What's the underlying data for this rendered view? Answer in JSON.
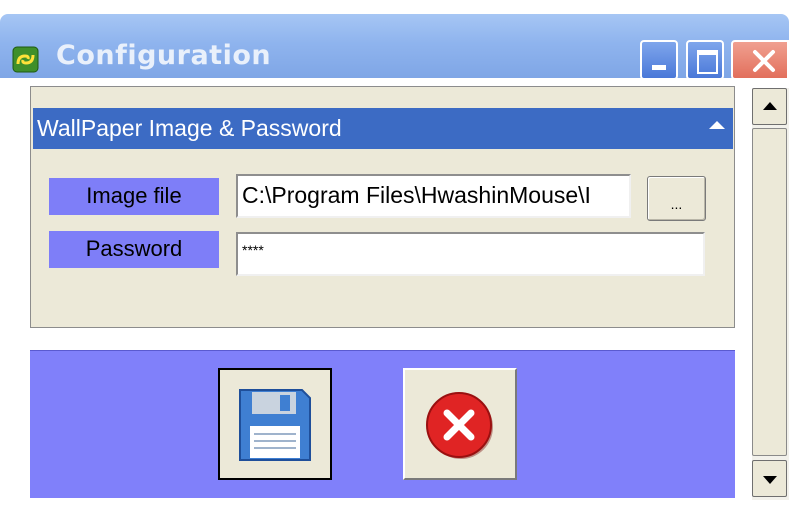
{
  "window": {
    "title": "Configuration",
    "icon": "app-green-link-icon",
    "title_bar_color": "#8fb4ee",
    "controls": [
      "minimize-icon",
      "maximize-icon",
      "close-icon"
    ]
  },
  "section": {
    "title": "WallPaper Image & Password",
    "header_color": "#3c6bc4",
    "collapse_icon": "chevron-up-icon"
  },
  "form": {
    "image_label": "Image file",
    "image_value": "C:\\Program Files\\HwashinMouse\\I",
    "browse_label": "...",
    "password_label": "Password",
    "password_value": "****",
    "label_color": "#7e7ef8"
  },
  "actions": {
    "save_icon": "floppy-disk-icon",
    "cancel_icon": "red-x-circle-icon",
    "bar_color": "#8080fa"
  }
}
